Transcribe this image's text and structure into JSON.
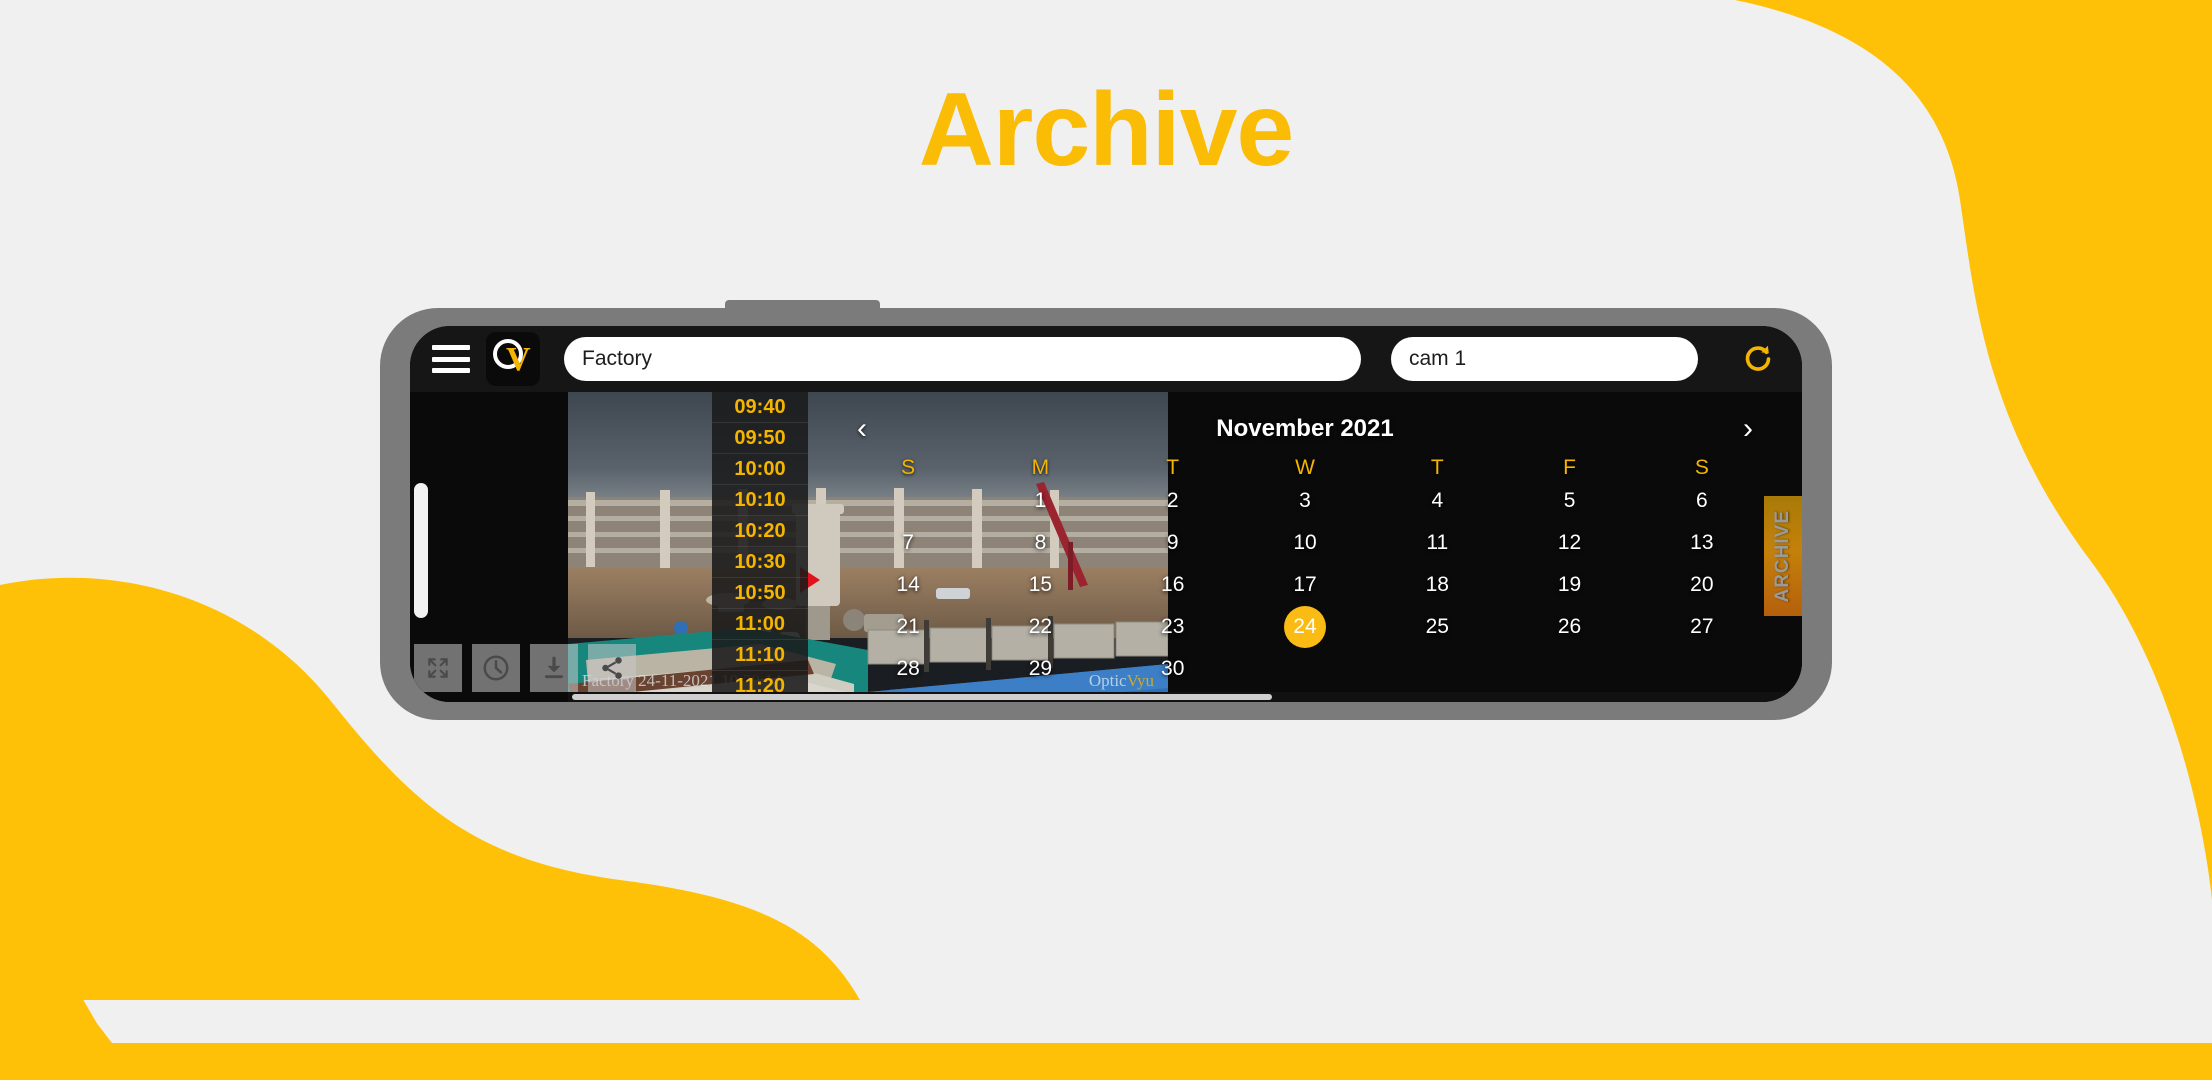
{
  "page": {
    "title": "Archive",
    "title_color": "#fbbc05",
    "background_color": "#f0f0f0",
    "accent_color": "#ffc107"
  },
  "app": {
    "topbar": {
      "menu_icon": "hamburger-menu-icon",
      "logo_letter_o": "O",
      "logo_letter_v": "V",
      "site_field_value": "Factory",
      "site_field_placeholder": "Factory",
      "camera_field_value": "cam 1",
      "camera_field_placeholder": "cam 1",
      "refresh_icon": "refresh-icon"
    },
    "video": {
      "watermark_left": "Factory 24-11-2021 10:20:14",
      "watermark_brand_white": "Optic",
      "watermark_brand_yellow": "Vyu",
      "playhead_marker": "play-marker",
      "controls": [
        {
          "name": "fullscreen-button",
          "icon": "fullscreen-icon"
        },
        {
          "name": "timelapse-button",
          "icon": "clock-icon"
        },
        {
          "name": "download-button",
          "icon": "download-icon"
        },
        {
          "name": "share-button",
          "icon": "share-icon"
        }
      ]
    },
    "time_list": {
      "times": [
        "09:40",
        "09:50",
        "10:00",
        "10:10",
        "10:20",
        "10:30",
        "10:50",
        "11:00",
        "11:10",
        "11:20"
      ]
    },
    "calendar": {
      "prev_label": "‹",
      "next_label": "›",
      "month_label": "November 2021",
      "weekdays": [
        "S",
        "M",
        "T",
        "W",
        "T",
        "F",
        "S"
      ],
      "leading_blanks": 1,
      "days": [
        1,
        2,
        3,
        4,
        5,
        6,
        7,
        8,
        9,
        10,
        11,
        12,
        13,
        14,
        15,
        16,
        17,
        18,
        19,
        20,
        21,
        22,
        23,
        24,
        25,
        26,
        27,
        28,
        29,
        30
      ],
      "selected_day": 24,
      "selected_color": "#f9bb14",
      "weekday_color": "#f4b400"
    },
    "archive_tab": {
      "label": "ARCHIVE"
    }
  }
}
